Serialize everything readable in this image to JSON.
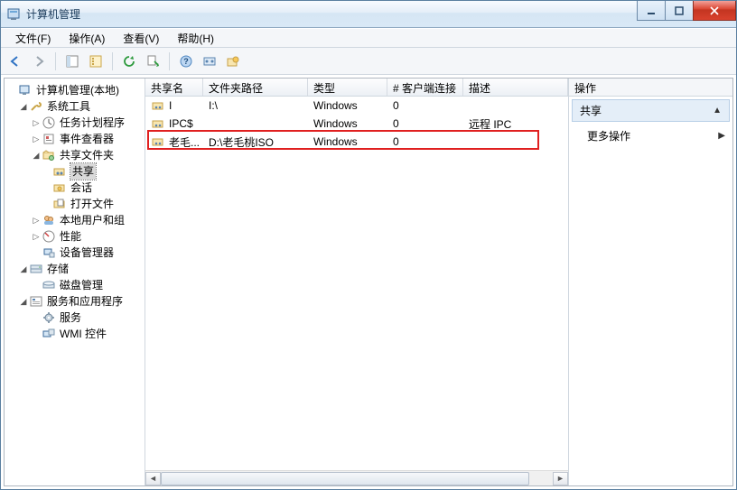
{
  "window": {
    "title": "计算机管理"
  },
  "menu": {
    "file": "文件(F)",
    "action": "操作(A)",
    "view": "查看(V)",
    "help": "帮助(H)"
  },
  "tree": {
    "root": "计算机管理(本地)",
    "system_tools": "系统工具",
    "task_scheduler": "任务计划程序",
    "event_viewer": "事件查看器",
    "shared_folders": "共享文件夹",
    "shares": "共享",
    "sessions": "会话",
    "open_files": "打开文件",
    "local_users": "本地用户和组",
    "performance": "性能",
    "device_manager": "设备管理器",
    "storage": "存储",
    "disk_management": "磁盘管理",
    "services_apps": "服务和应用程序",
    "services": "服务",
    "wmi_control": "WMI 控件"
  },
  "columns": {
    "name": "共享名",
    "path": "文件夹路径",
    "type": "类型",
    "clients": "# 客户端连接",
    "desc": "描述"
  },
  "rows": [
    {
      "name": "I",
      "path": "I:\\",
      "type": "Windows",
      "clients": "0",
      "desc": ""
    },
    {
      "name": "IPC$",
      "path": "",
      "type": "Windows",
      "clients": "0",
      "desc": "远程 IPC"
    },
    {
      "name": "老毛...",
      "path": "D:\\老毛桃ISO",
      "type": "Windows",
      "clients": "0",
      "desc": ""
    }
  ],
  "actions": {
    "header": "操作",
    "section": "共享",
    "more": "更多操作"
  }
}
